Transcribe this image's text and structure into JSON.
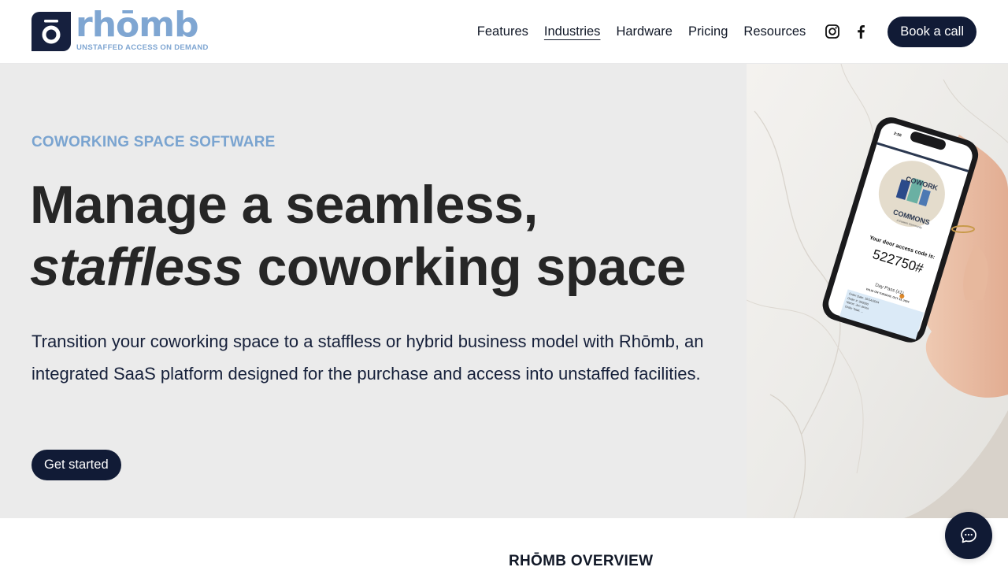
{
  "brand": {
    "name": "rhōmb",
    "tagline": "UNSTAFFED ACCESS ON DEMAND",
    "colors": {
      "navy": "#111b36",
      "light_blue": "#7aa4d0",
      "hero_bg": "#ebebeb"
    }
  },
  "nav": {
    "items": [
      {
        "label": "Features",
        "active": false
      },
      {
        "label": "Industries",
        "active": true
      },
      {
        "label": "Hardware",
        "active": false
      },
      {
        "label": "Pricing",
        "active": false
      },
      {
        "label": "Resources",
        "active": false
      }
    ],
    "social": [
      "instagram-icon",
      "facebook-icon"
    ],
    "cta_label": "Book a call"
  },
  "hero": {
    "eyebrow": "COWORKING SPACE SOFTWARE",
    "headline_line1": "Manage a seamless,",
    "headline_emphasis": "staffless",
    "headline_line2_rest": " coworking space",
    "description": "Transition your coworking space to a staffless or hybrid business model with Rhōmb, an integrated SaaS platform designed for the purchase and access into unstaffed facilities.",
    "cta_label": "Get started"
  },
  "phone_screen": {
    "logo_top": "COWORK",
    "logo_bottom": "COMMONS",
    "logo_sub": "A Cowork Community",
    "code_label": "Your door access code is:",
    "code": "522750#",
    "pass": "Day Pass (x1)",
    "valid": "VALID ON TUESDAY, OCT 15, 2024",
    "order_lines": [
      "Order Date: 10/14/2024",
      "Order #: 000000",
      "Name: Jon Jones",
      "Order Total: ..."
    ],
    "status_time": "2:56"
  },
  "section": {
    "overview_heading": "RHŌMB OVERVIEW"
  },
  "chat": {
    "icon": "chat-bubble-icon"
  }
}
